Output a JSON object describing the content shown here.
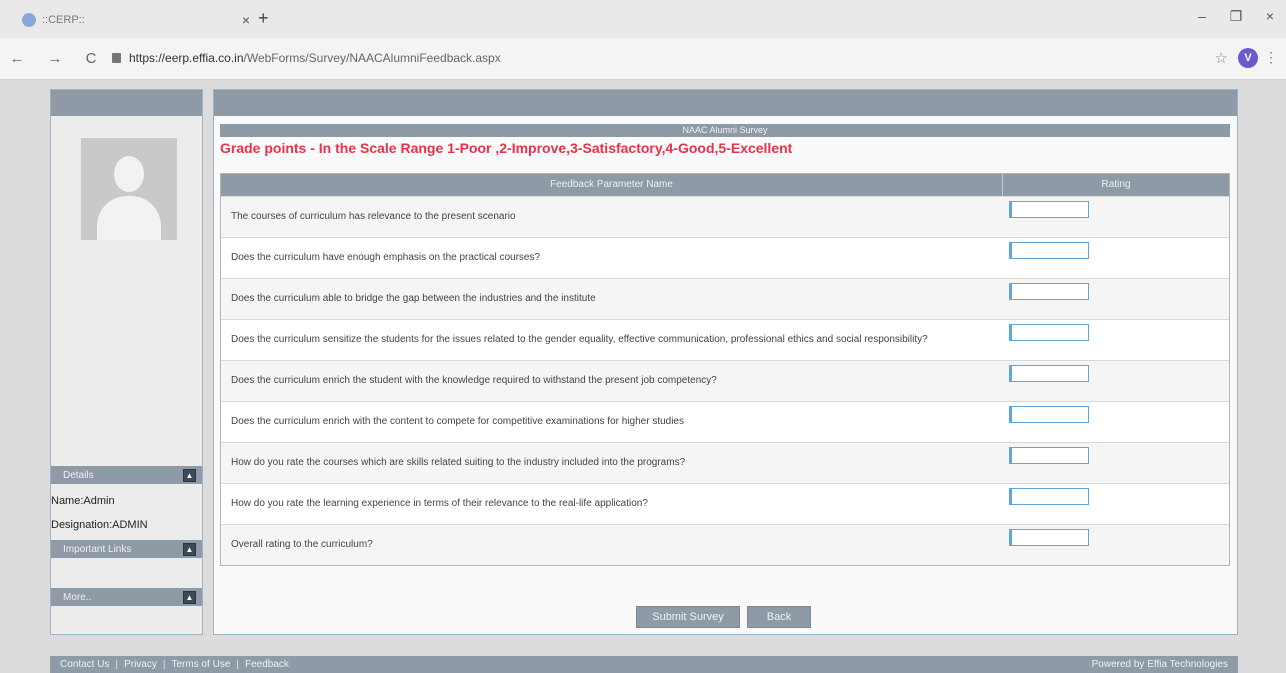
{
  "browser": {
    "tab_title": "::CERP::",
    "tab_close": "×",
    "new_tab": "+",
    "win_min": "–",
    "win_max": "❐",
    "win_close": "×",
    "back": "←",
    "forward": "→",
    "reload": "C",
    "url_host": "https://eerp.effia.co.in",
    "url_path": "/WebForms/Survey/NAACAlumniFeedback.aspx",
    "star": "☆",
    "profile_initial": "V",
    "menu": "⋮"
  },
  "sidebar": {
    "details_label": "Details",
    "name_line": "Name:Admin",
    "designation_line": "Designation:ADMIN",
    "important_links_label": "Important Links",
    "more_label": "More..",
    "collapse_glyph": "▲"
  },
  "survey": {
    "title": "NAAC Alumni Survey",
    "grade_text": "Grade points - In the Scale Range 1-Poor ,2-Improve,3-Satisfactory,4-Good,5-Excellent",
    "col_param": "Feedback Parameter Name",
    "col_rating": "Rating",
    "questions": [
      {
        "text": "The courses of curriculum has relevance to the present scenario",
        "value": ""
      },
      {
        "text": "Does the curriculum have enough emphasis on the practical courses?",
        "value": ""
      },
      {
        "text": "Does the curriculum able to bridge the gap between the industries and the institute",
        "value": ""
      },
      {
        "text": "Does the curriculum sensitize the students for the issues related to the gender equality, effective communication, professional ethics and social responsibility?",
        "value": ""
      },
      {
        "text": "Does the curriculum enrich the student with the knowledge required to withstand the present job competency?",
        "value": ""
      },
      {
        "text": "Does the curriculum enrich with the content to compete for competitive examinations for higher studies",
        "value": ""
      },
      {
        "text": "How do you rate the courses which are skills related suiting to the industry included into the programs?",
        "value": ""
      },
      {
        "text": "How do you rate the learning experience in terms of their relevance to the real-life application?",
        "value": ""
      },
      {
        "text": "Overall rating to the curriculum?",
        "value": ""
      }
    ],
    "submit_label": "Submit Survey",
    "back_label": "Back"
  },
  "footer": {
    "links": [
      "Contact Us",
      "Privacy",
      "Terms of Use",
      "Feedback"
    ],
    "separator": "|",
    "powered_by": "Powered by Effia Technologies"
  }
}
